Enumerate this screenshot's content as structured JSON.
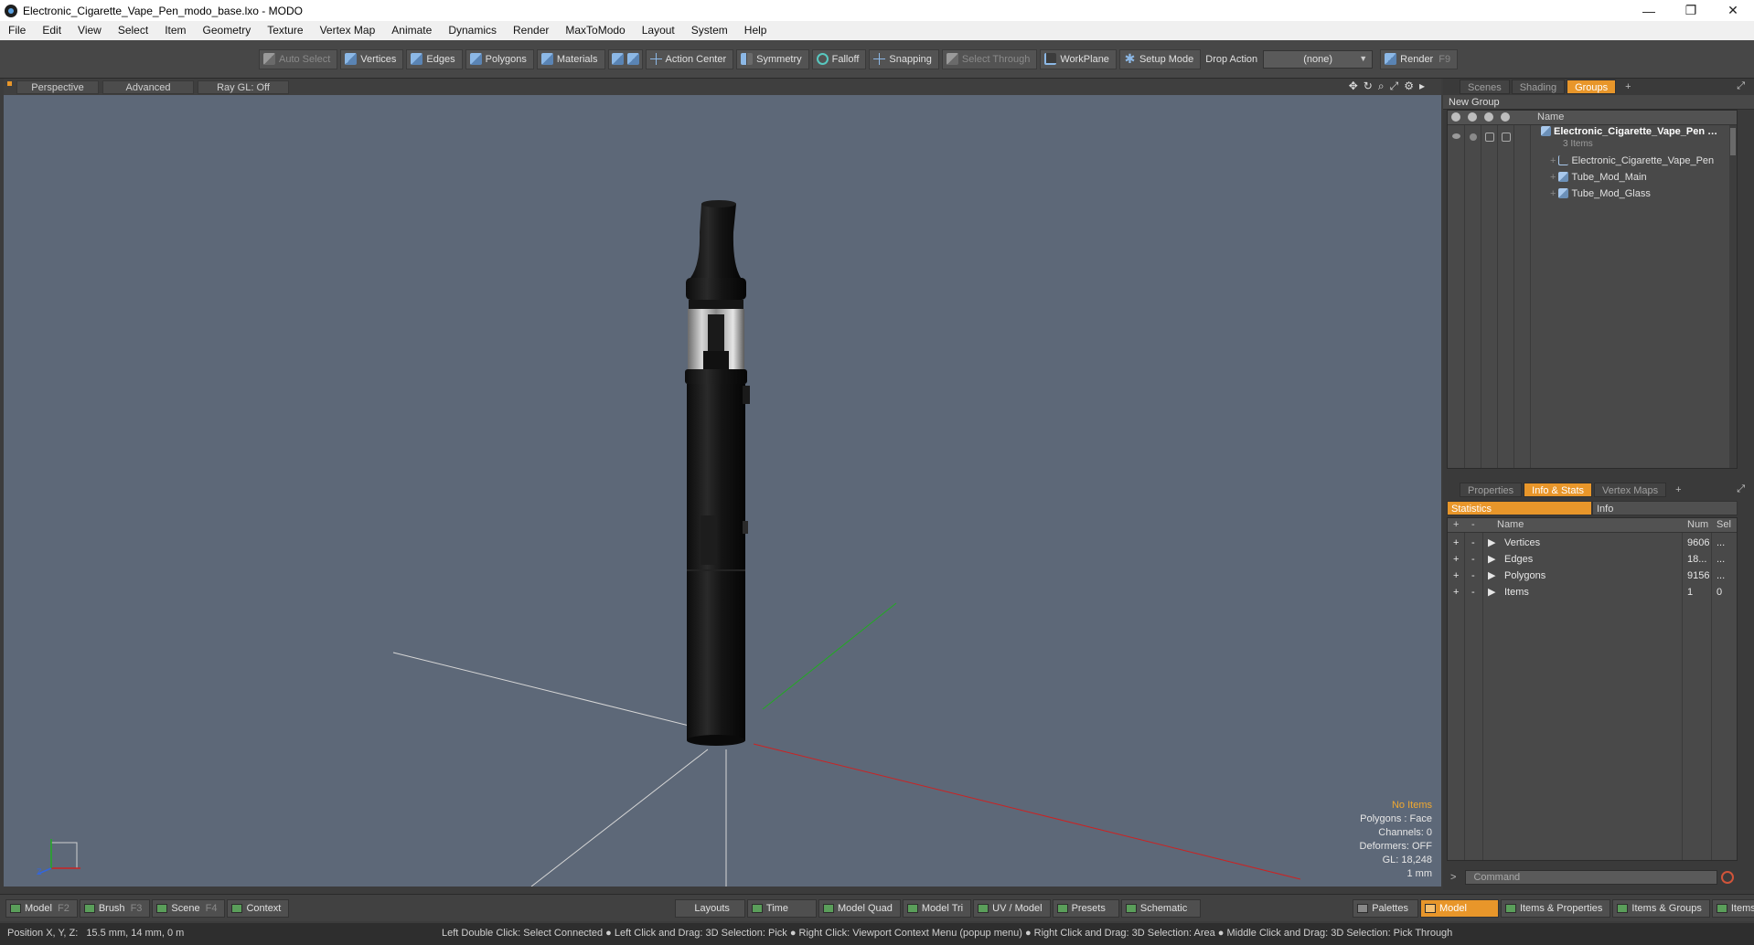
{
  "window": {
    "title": "Electronic_Cigarette_Vape_Pen_modo_base.lxo - MODO",
    "controls": [
      "—",
      "❐",
      "✕"
    ]
  },
  "menu": [
    "File",
    "Edit",
    "View",
    "Select",
    "Item",
    "Geometry",
    "Texture",
    "Vertex Map",
    "Animate",
    "Dynamics",
    "Render",
    "MaxToModo",
    "Layout",
    "System",
    "Help"
  ],
  "toolbar": {
    "auto_select": "Auto Select",
    "vertices": "Vertices",
    "edges": "Edges",
    "polygons": "Polygons",
    "materials": "Materials",
    "action_center": "Action Center",
    "symmetry": "Symmetry",
    "falloff": "Falloff",
    "snapping": "Snapping",
    "select_through": "Select Through",
    "workplane": "WorkPlane",
    "setup_mode": "Setup Mode",
    "drop_action_label": "Drop Action",
    "drop_action_value": "(none)",
    "render": "Render",
    "render_key": "F9"
  },
  "viewport": {
    "tabs": [
      "Perspective",
      "Advanced",
      "Ray GL: Off"
    ],
    "stats": {
      "items": "No Items",
      "polygons": "Polygons : Face",
      "channels": "Channels: 0",
      "deformers": "Deformers: OFF",
      "gl": "GL: 18,248",
      "unit": "1 mm"
    }
  },
  "scene_panel": {
    "tabs": [
      "Scenes",
      "Shading",
      "Groups"
    ],
    "active_tab": "Groups",
    "new_group": "New Group",
    "name_header": "Name",
    "group_name": "Electronic_Cigarette_Vape_Pen",
    "group_count": "3 Items",
    "items": [
      "Electronic_Cigarette_Vape_Pen",
      "Tube_Mod_Main",
      "Tube_Mod_Glass"
    ]
  },
  "info_panel": {
    "tabs": [
      "Properties",
      "Info & Stats",
      "Vertex Maps"
    ],
    "active_tab": "Info & Stats",
    "toggle": [
      "Statistics",
      "Info"
    ],
    "headers": {
      "name": "Name",
      "num": "Num",
      "sel": "Sel"
    },
    "rows": [
      {
        "name": "Vertices",
        "num": "9606",
        "sel": "..."
      },
      {
        "name": "Edges",
        "num": "18...",
        "sel": "..."
      },
      {
        "name": "Polygons",
        "num": "9156",
        "sel": "..."
      },
      {
        "name": "Items",
        "num": "1",
        "sel": "0"
      }
    ],
    "command_placeholder": "Command"
  },
  "bottom_bar": {
    "left": [
      {
        "label": "Model",
        "key": "F2"
      },
      {
        "label": "Brush",
        "key": "F3"
      },
      {
        "label": "Scene",
        "key": "F4"
      },
      {
        "label": "Context",
        "key": ""
      }
    ],
    "center": [
      "Layouts",
      "Time",
      "Model Quad",
      "Model Tri",
      "UV / Model",
      "Presets",
      "Schematic"
    ],
    "right": [
      "Palettes",
      "Model",
      "Items & Properties",
      "Items & Groups",
      "Items & Shading"
    ],
    "active": "Model"
  },
  "status": {
    "position_label": "Position X, Y, Z:",
    "position_value": "15.5 mm, 14 mm, 0 m",
    "hints": "Left Double Click: Select Connected ● Left Click and Drag: 3D Selection: Pick ● Right Click: Viewport Context Menu (popup menu) ● Right Click and Drag: 3D Selection: Area ● Middle Click and Drag: 3D Selection: Pick Through"
  },
  "colors": {
    "viewport_bg": "#5d6878",
    "accent": "#e8962a",
    "axis_x": "#cc2222",
    "axis_y": "#22aa22"
  }
}
